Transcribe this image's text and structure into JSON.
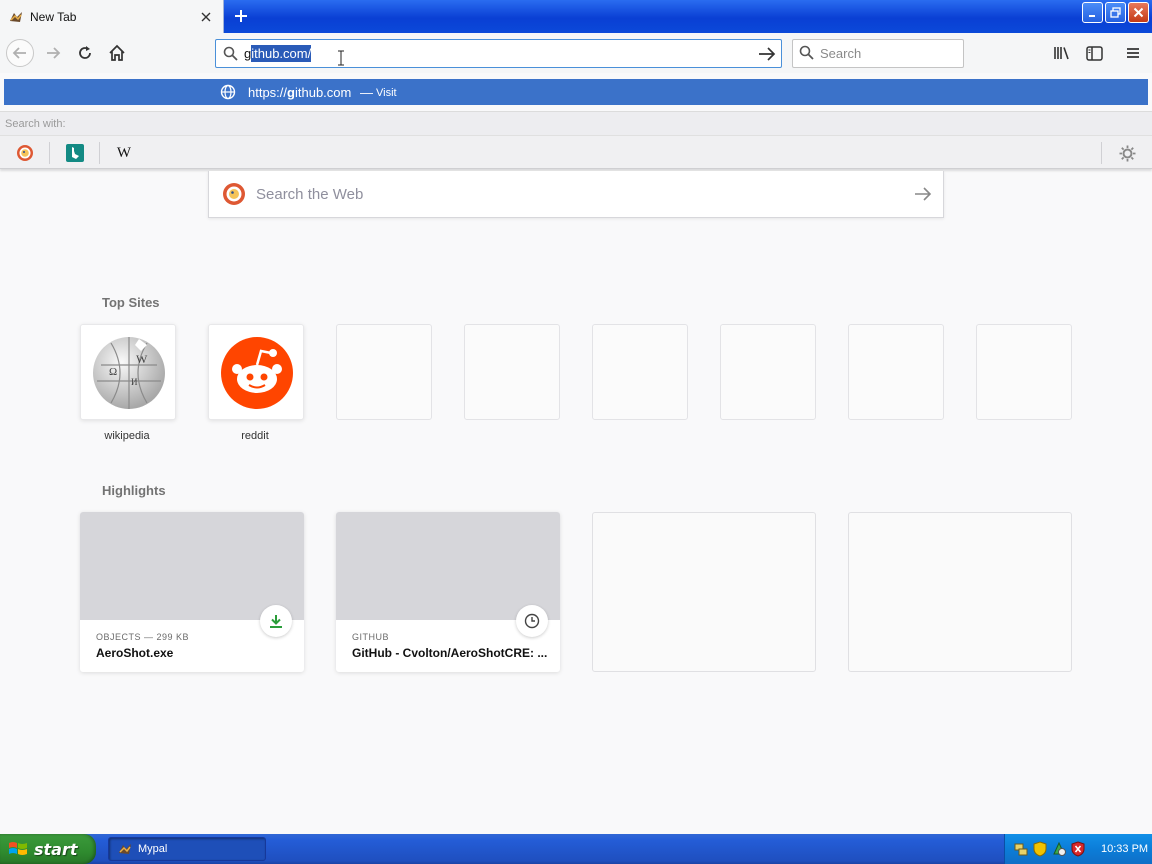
{
  "tab": {
    "title": "New Tab"
  },
  "urlbar": {
    "typed": "g",
    "selected": "ithub.com/"
  },
  "searchbar": {
    "placeholder": "Search"
  },
  "autocomplete": {
    "url_prefix": "https://",
    "url_bold": "g",
    "url_rest": "ithub.com",
    "separator": "—",
    "action": "Visit"
  },
  "search_with": {
    "label": "Search with:"
  },
  "engines": [
    {
      "name": "duckduckgo",
      "icon": "duckduckgo-icon"
    },
    {
      "name": "bing",
      "icon": "bing-icon"
    },
    {
      "name": "wikipedia",
      "glyph": "W",
      "icon": "wikipedia-w-icon"
    }
  ],
  "web_search": {
    "placeholder": "Search the Web"
  },
  "top_sites": {
    "title": "Top Sites",
    "sites": [
      {
        "label": "wikipedia",
        "icon": "wikipedia-globe-icon"
      },
      {
        "label": "reddit",
        "icon": "reddit-icon"
      }
    ]
  },
  "highlights": {
    "title": "Highlights",
    "cards": [
      {
        "meta": "OBJECTS — 299 KB",
        "title": "AeroShot.exe",
        "badge": "download-icon"
      },
      {
        "meta": "GITHUB",
        "title": "GitHub - Cvolton/AeroShotCRE: ...",
        "badge": "clock-icon"
      }
    ]
  },
  "taskbar": {
    "start_label": "start",
    "task_label": "Mypal",
    "clock": "10:33 PM"
  },
  "colors": {
    "accent": "#3b72c9",
    "reddit": "#ff4500",
    "taskbar": "#245dd7",
    "start": "#2f8b2f"
  }
}
